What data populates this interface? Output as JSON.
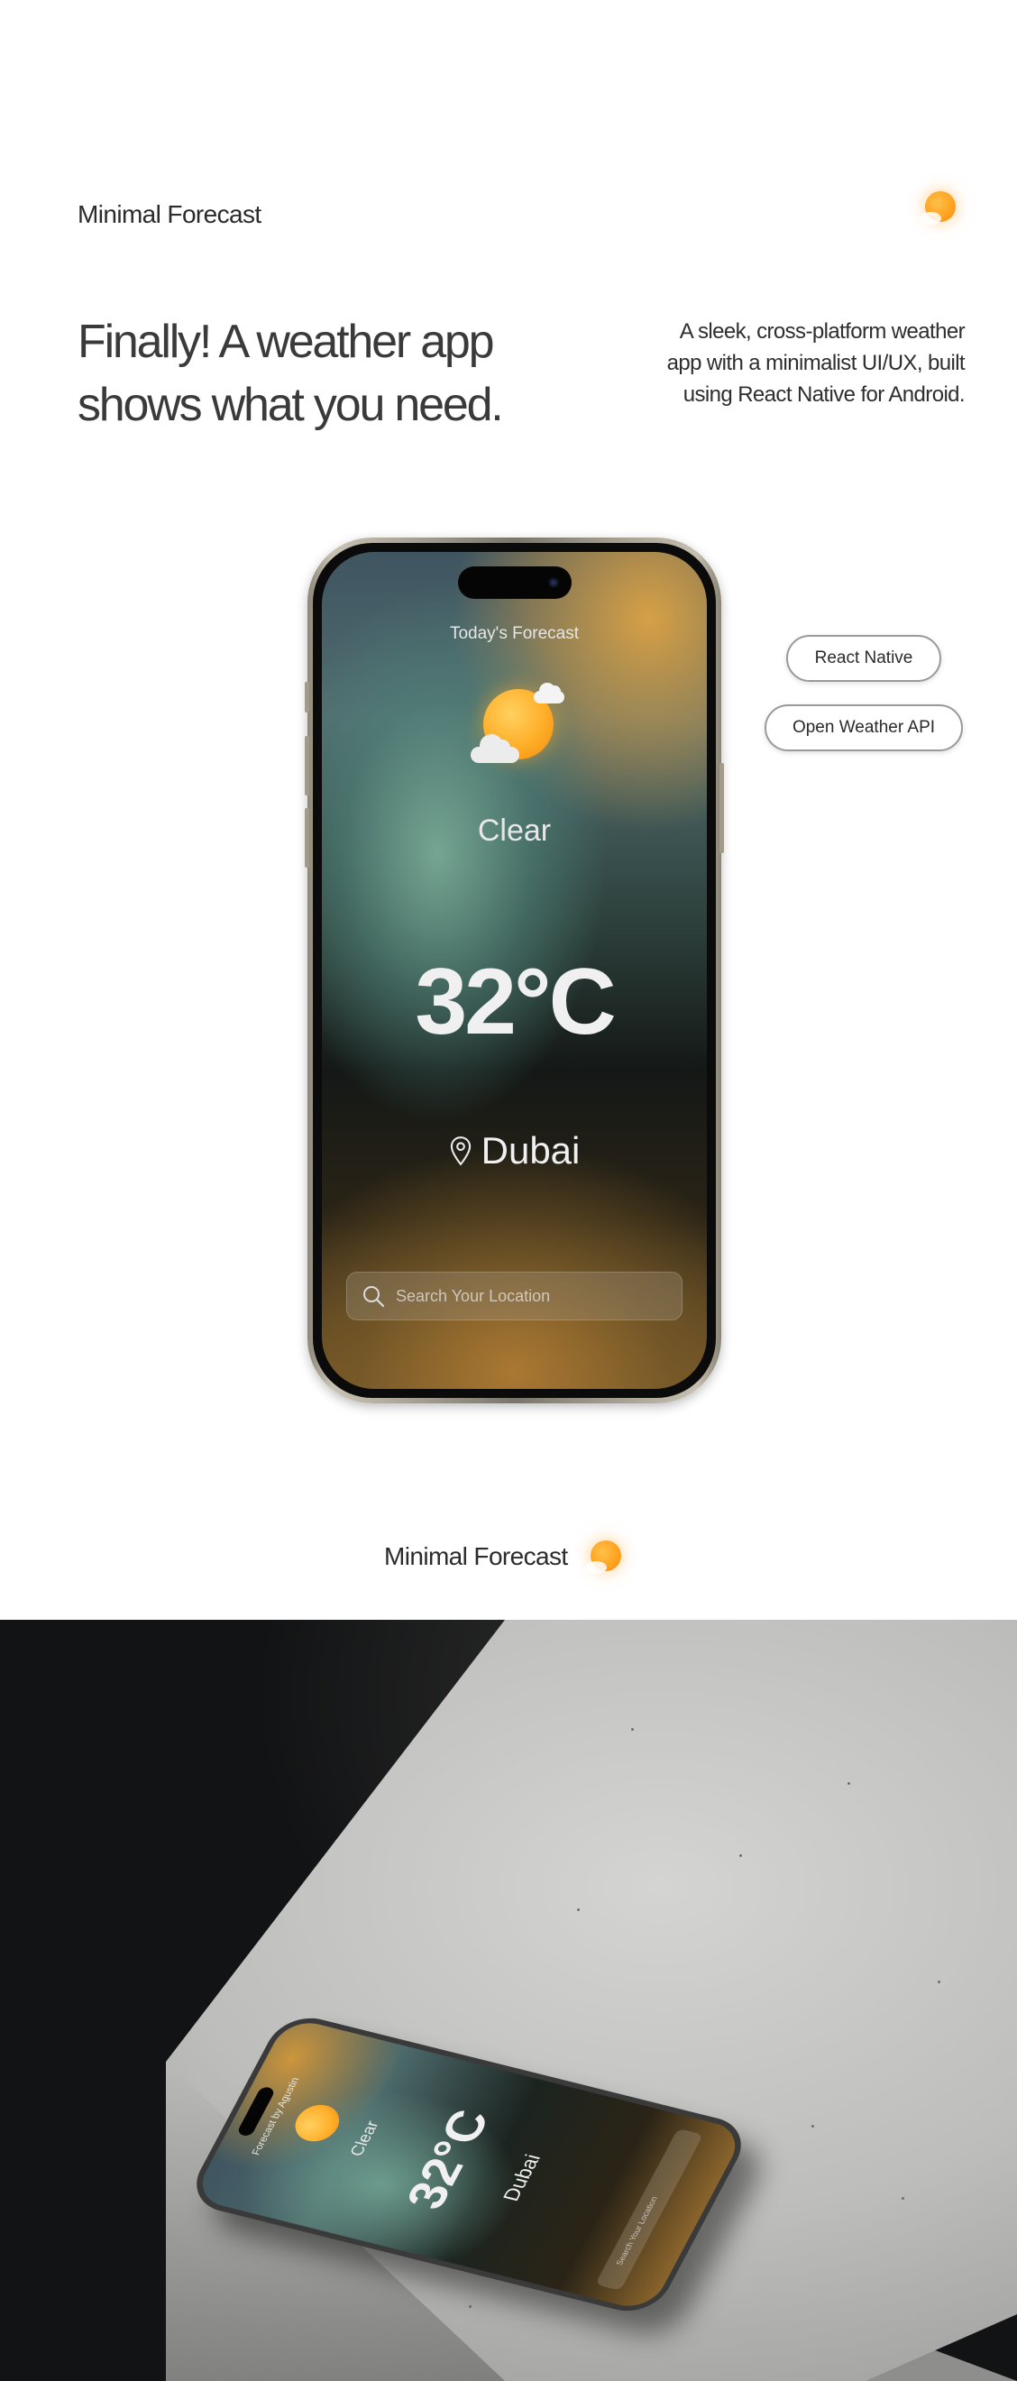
{
  "brand": {
    "name": "Minimal Forecast",
    "logo_icon": "sun-logo-icon",
    "logo_color": "#ffa321"
  },
  "hero": {
    "headline_line1": "Finally! A weather app",
    "headline_line2": "shows what you need.",
    "description_line1": "A sleek, cross-platform weather",
    "description_line2": "app with a minimalist UI/UX, built",
    "description_line3": "using React Native for Android."
  },
  "tags": [
    "React Native",
    "Open Weather API"
  ],
  "app_screen": {
    "title": "Today's Forecast",
    "weather_icon": "sun-with-clouds-icon",
    "condition": "Clear",
    "temperature": "32°C",
    "location_icon": "map-pin-icon",
    "city": "Dubai",
    "search_icon": "search-icon",
    "search_placeholder": "Search Your Location"
  },
  "footer_brand": {
    "name": "Minimal Forecast"
  },
  "render_scene": {
    "title": "Forecast by Agustin",
    "condition": "Clear",
    "temperature": "32°C",
    "city": "Dubai",
    "search_placeholder": "Search Your Location"
  }
}
